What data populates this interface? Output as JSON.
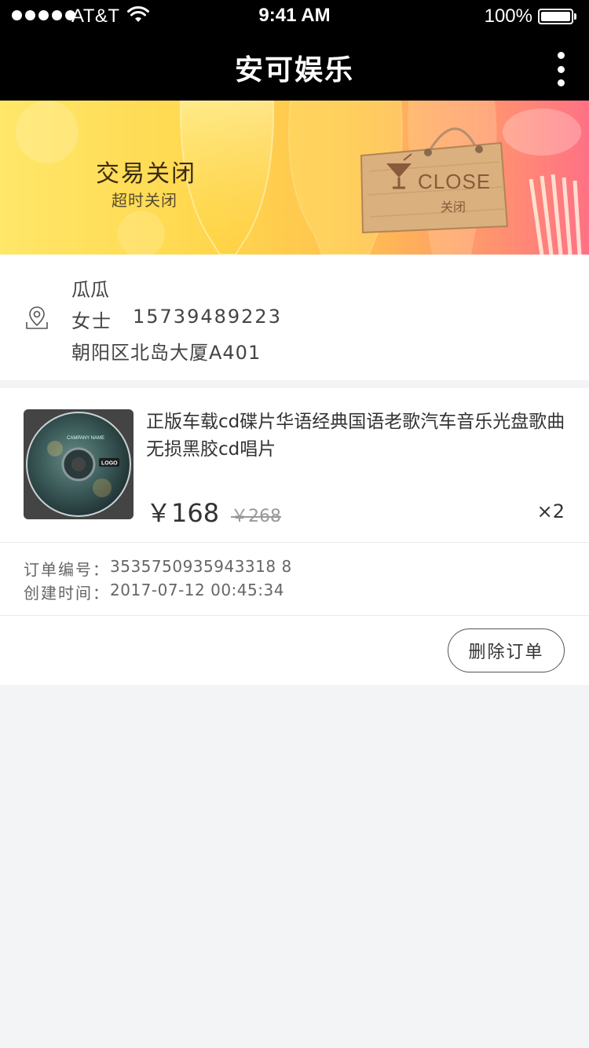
{
  "status_bar": {
    "carrier": "AT&T",
    "time": "9:41 AM",
    "battery": "100%"
  },
  "nav": {
    "title": "安可娱乐"
  },
  "banner": {
    "status": "交易关闭",
    "reason": "超时关闭",
    "sign_text": "CLOSE",
    "sign_subtext": "关闭"
  },
  "address": {
    "name": "瓜瓜",
    "title": "女士",
    "phone": "15739489223",
    "line": "朝阳区北岛大厦A401"
  },
  "order": {
    "product_title": "正版车载cd碟片华语经典国语老歌汽车音乐光盘歌曲无损黑胶cd唱片",
    "disc_label": "CAMPANY NAME",
    "disc_logo": "LOGO",
    "price": "￥168",
    "original_price": "￥268",
    "quantity": "×2",
    "order_no_label": "订单编号：",
    "order_no": "3535750935943318 8",
    "created_label": "创建时间：",
    "created_at": "2017-07-12 00:45:34",
    "delete_label": "删除订单"
  },
  "colors": {
    "nav_bg": "#000000",
    "banner_start": "#ffe45a",
    "banner_end": "#ff5a7a",
    "page_bg": "#f3f4f6"
  }
}
